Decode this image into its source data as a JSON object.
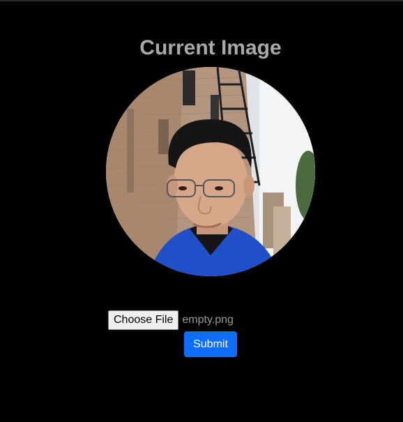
{
  "header": {
    "title": "Current Image"
  },
  "profile": {
    "image_alt": "Current profile photo"
  },
  "upload": {
    "choose_file_label": "Choose File",
    "file_name": "empty.png",
    "submit_label": "Submit"
  },
  "colors": {
    "background": "#000000",
    "title": "#a9a9a9",
    "submit": "#0d6efd",
    "file_name": "#9a9a9a"
  }
}
